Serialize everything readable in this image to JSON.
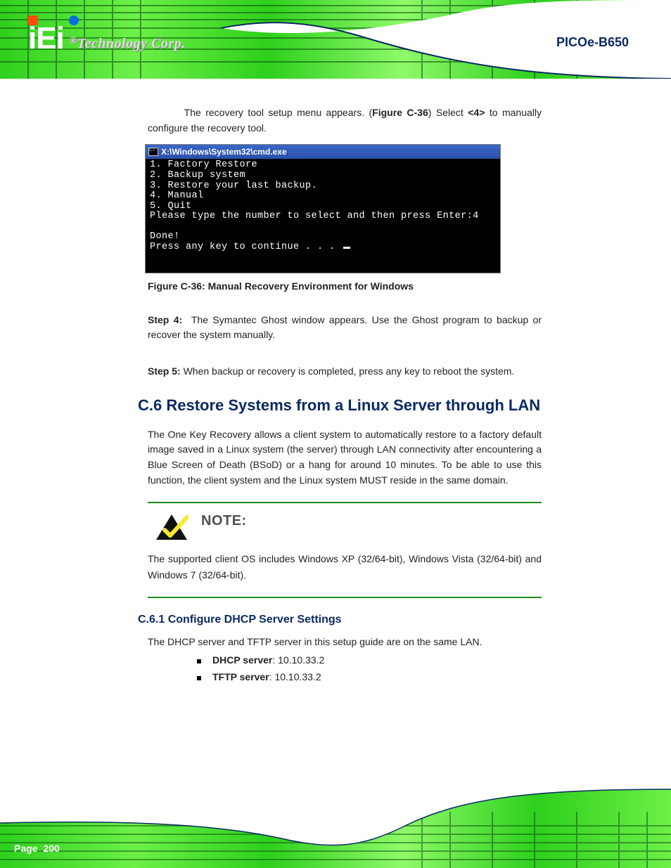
{
  "brand": {
    "logo_text": "iEi",
    "tagline": "Technology Corp.",
    "reg": "®"
  },
  "header": {
    "product": "PICOe-B650"
  },
  "intro": {
    "text_before_bold": "The recovery tool setup menu appears. (",
    "fig_ref": "Figure C-36",
    "text_after_bold": ") Select ",
    "option_bold": "<4>",
    "after_option": " to manually configure the recovery tool."
  },
  "terminal": {
    "title": "X:\\Windows\\System32\\cmd.exe",
    "lines": [
      "1. Factory Restore",
      "2. Backup system",
      "3. Restore your last backup.",
      "4. Manual",
      "5. Quit",
      "Please type the number to select and then press Enter:4",
      "",
      "Done!",
      "Press any key to continue . . ."
    ]
  },
  "figure_caption": {
    "label": "Figure C-36: ",
    "text": "Manual Recovery Environment for Windows"
  },
  "para2": {
    "prefix": "Step 4:  The Symantec Ghost window appears. Use the Ghost program to backup or recover the system manually.",
    "step_label": "Step 4:"
  },
  "para3": {
    "step_label": "Step 5:",
    "text": "  When backup or recovery is completed, press any key to reboot the system."
  },
  "sections": {
    "h2": "C.6 Restore Systems from a Linux Server through LAN",
    "h2_body": "The One Key Recovery allows a client system to automatically restore to a factory default image saved in a Linux system (the server) through LAN connectivity after encountering a Blue Screen of Death (BSoD) or a hang for around 10 minutes. To be able to use this function, the client system and the Linux system MUST reside in the same domain.",
    "h3": "C.6.1 Configure DHCP Server Settings"
  },
  "note": {
    "title": "NOTE:",
    "body": "The supported client OS includes Windows XP (32/64-bit), Windows Vista (32/64-bit) and Windows 7 (32/64-bit)."
  },
  "steps": {
    "intro": "The DHCP server and TFTP server in this setup guide are on the same LAN.",
    "items": [
      {
        "label": "DHCP server",
        "desc": ": 10.10.33.2"
      },
      {
        "label": "TFTP server",
        "desc": ": 10.10.33.2"
      }
    ]
  },
  "footer": {
    "page_label": "Page",
    "page_number": "200"
  }
}
